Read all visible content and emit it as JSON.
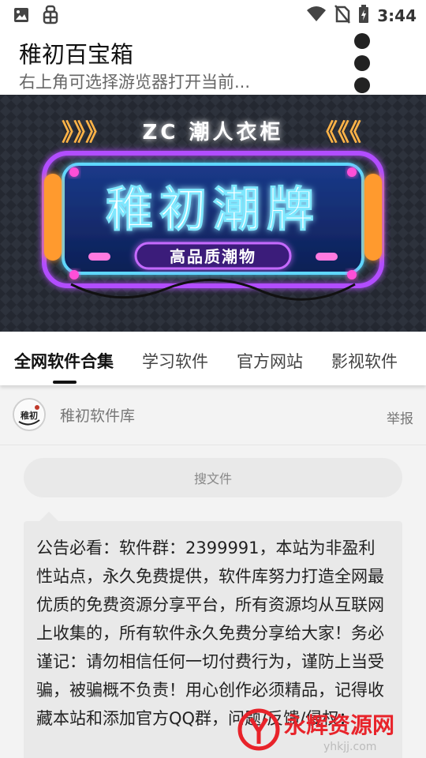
{
  "status_bar": {
    "time": "3:44",
    "icons": [
      "image-icon",
      "bug-icon",
      "wifi-icon",
      "no-sim-icon",
      "battery-charging-icon"
    ]
  },
  "header": {
    "title": "稚初百宝箱",
    "subtitle": "右上角可选择游览器打开当前...",
    "menu_icon": "more-vertical-icon"
  },
  "banner": {
    "top_line": "ZC  潮人衣柜",
    "headline": "稚初潮牌",
    "tagline": "高品质潮物",
    "left_arrows": "》》》",
    "right_arrows": "《《《",
    "accent_purple": "#b24dff",
    "accent_orange": "#ff9a2e",
    "accent_blue": "#5fd7ff"
  },
  "tabs": [
    {
      "label": "全网软件合集",
      "active": true
    },
    {
      "label": "学习软件",
      "active": false
    },
    {
      "label": "官方网站",
      "active": false
    },
    {
      "label": "影视软件",
      "active": false
    }
  ],
  "source": {
    "name": "稚初软件库",
    "avatar_text": "稚初",
    "report_label": "举报"
  },
  "search": {
    "placeholder": "搜文件"
  },
  "notice": {
    "text": "公告必看：软件群：2399991，本站为非盈利性站点，永久免费提供，软件库努力打造全网最优质的免费资源分享平台，所有资源均从互联网上收集的，所有软件永久免费分享给大家！务必谨记：请勿相信任何一切付费行为，谨防上当受骗，被骗概不负责！用心创作必须精品，记得收藏本站和添加官方QQ群，问题/反馈/侵权："
  },
  "watermark": {
    "text": "永辉资源网",
    "url": "yhkjj.com",
    "color": "#e8232a"
  }
}
